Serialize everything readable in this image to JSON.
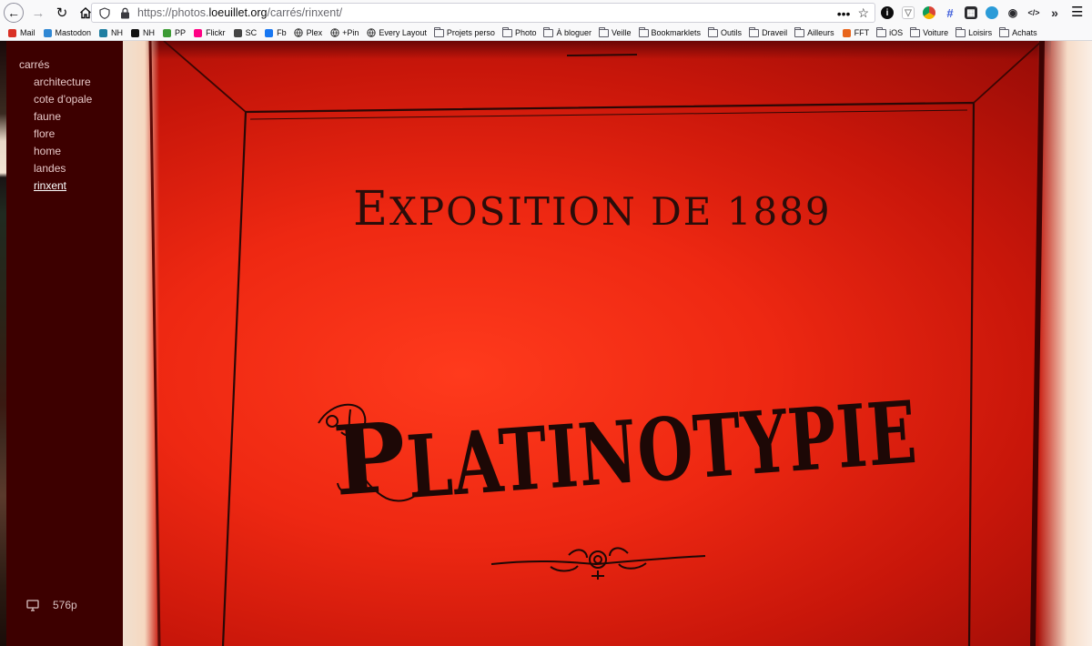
{
  "browser": {
    "url_prefix": "https://photos.",
    "url_host": "loeuillet.org",
    "url_path": "/carrés/rinxent/"
  },
  "bookmarks": [
    {
      "label": "Mail",
      "icon": "gmail-icon",
      "color": "#d93025"
    },
    {
      "label": "Mastodon",
      "icon": "mastodon-icon",
      "color": "#3088d4"
    },
    {
      "label": "NH",
      "icon": "nh-icon",
      "color": "#1f7ea1"
    },
    {
      "label": "NH",
      "icon": "github-icon",
      "color": "#111111"
    },
    {
      "label": "PP",
      "icon": "pp-icon",
      "color": "#3d9b35"
    },
    {
      "label": "Flickr",
      "icon": "flickr-icon",
      "color": "#ff0084"
    },
    {
      "label": "SC",
      "icon": "sc-icon",
      "color": "#444444"
    },
    {
      "label": "Fb",
      "icon": "facebook-icon",
      "color": "#1877f2"
    },
    {
      "label": "Plex",
      "icon": "globe-icon",
      "color": "#333333"
    },
    {
      "label": "+Pin",
      "icon": "globe-icon",
      "color": "#333333"
    },
    {
      "label": "Every Layout",
      "icon": "globe-icon",
      "color": "#333333"
    },
    {
      "label": "Projets perso",
      "icon": "folder-icon",
      "color": "#5b5b66"
    },
    {
      "label": "Photo",
      "icon": "folder-icon",
      "color": "#5b5b66"
    },
    {
      "label": "À bloguer",
      "icon": "folder-icon",
      "color": "#5b5b66"
    },
    {
      "label": "Veille",
      "icon": "folder-icon",
      "color": "#5b5b66"
    },
    {
      "label": "Bookmarklets",
      "icon": "folder-icon",
      "color": "#5b5b66"
    },
    {
      "label": "Outils",
      "icon": "folder-icon",
      "color": "#5b5b66"
    },
    {
      "label": "Draveil",
      "icon": "folder-icon",
      "color": "#5b5b66"
    },
    {
      "label": "Ailleurs",
      "icon": "folder-icon",
      "color": "#5b5b66"
    },
    {
      "label": "FFT",
      "icon": "fft-icon",
      "color": "#e8641b"
    },
    {
      "label": "iOS",
      "icon": "folder-icon",
      "color": "#5b5b66"
    },
    {
      "label": "Voiture",
      "icon": "folder-icon",
      "color": "#5b5b66"
    },
    {
      "label": "Loisirs",
      "icon": "folder-icon",
      "color": "#5b5b66"
    },
    {
      "label": "Achats",
      "icon": "folder-icon",
      "color": "#5b5b66"
    }
  ],
  "sidebar": {
    "root_label": "carrés",
    "items": [
      {
        "label": "architecture",
        "active": false
      },
      {
        "label": "cote d'opale",
        "active": false
      },
      {
        "label": "faune",
        "active": false
      },
      {
        "label": "flore",
        "active": false
      },
      {
        "label": "home",
        "active": false
      },
      {
        "label": "landes",
        "active": false
      },
      {
        "label": "rinxent",
        "active": true
      }
    ],
    "resolution_label": "576p"
  },
  "photo": {
    "line1_big": "E",
    "line1_rest": "XPOSITION DE 1889",
    "title_big": "P",
    "title_rest": "LATINOTYPIE"
  },
  "colors": {
    "sidebar_bg": "#3d0000",
    "photo_red": "#ee2812"
  }
}
